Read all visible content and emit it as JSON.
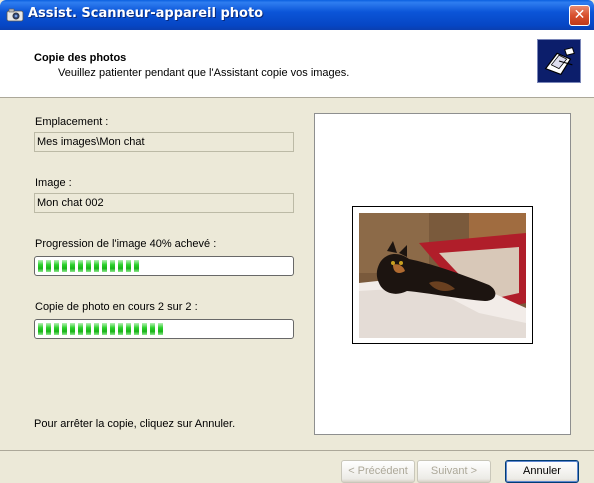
{
  "window": {
    "title": "Assist. Scanneur-appareil photo",
    "close_glyph": "✕"
  },
  "header": {
    "title": "Copie des photos",
    "subtitle": "Veuillez patienter pendant que l'Assistant copie vos images.",
    "icon": "camera-scanner-icon"
  },
  "fields": {
    "location_label": "Emplacement :",
    "location_value": "Mes images\\Mon chat",
    "image_label": "Image :",
    "image_value": "Mon chat 002"
  },
  "progress": {
    "image_label": "Progression de l'image 40% achevé :",
    "image_percent": 40,
    "copy_label": "Copie de photo en cours 2 sur 2 :",
    "copy_percent": 50
  },
  "status": {
    "stop_text": "Pour arrêter la copie, cliquez sur Annuler."
  },
  "buttons": {
    "back": "< Précédent",
    "next": "Suivant >",
    "cancel": "Annuler"
  },
  "preview": {
    "image": "cat-photo-thumbnail"
  },
  "colors": {
    "titlebar": "#0a55d8",
    "progress_fill": "#27d42b",
    "window_bg": "#ece9d8"
  }
}
